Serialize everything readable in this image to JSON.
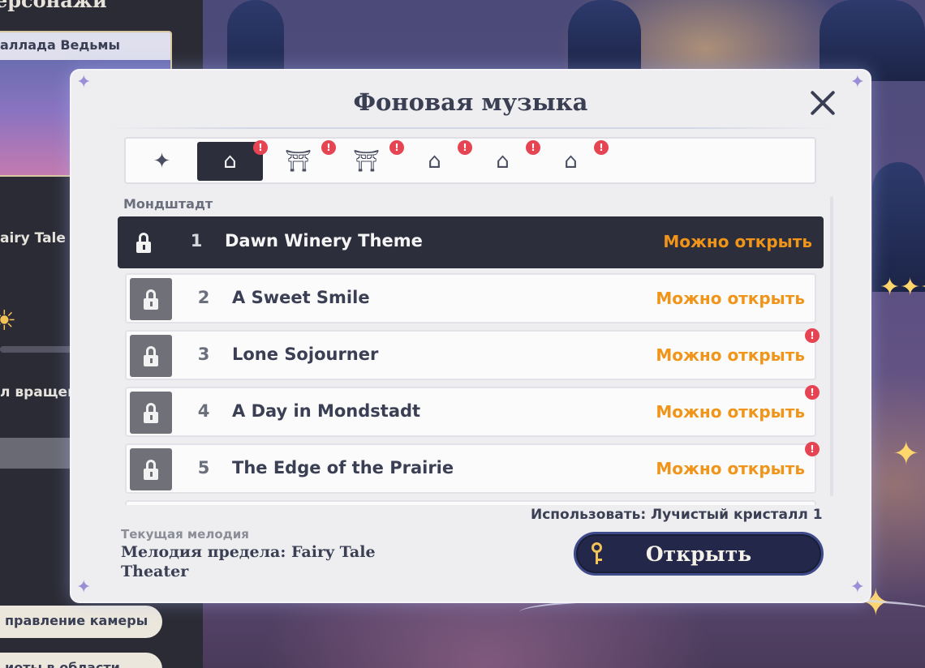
{
  "side_panel": {
    "title": "ерсонажи",
    "card_label": "аллада Ведьмы",
    "row_fairy_tale": "airy Tale",
    "row_rotation": "л вращени",
    "pill_camera": "правление камеры",
    "pill_area": "иоты в области"
  },
  "dialog": {
    "title": "Фоновая музыка",
    "section_label": "Мондштадт",
    "tabs": [
      {
        "icon": "sparkle-star-icon",
        "glyph": "✦",
        "badge": ""
      },
      {
        "icon": "mondstadt-house-icon",
        "glyph": "⌂",
        "badge": "!"
      },
      {
        "icon": "liyue-pavilion-icon",
        "glyph": "⛩",
        "badge": "!"
      },
      {
        "icon": "inazuma-gate-icon",
        "glyph": "⛩",
        "badge": "!"
      },
      {
        "icon": "sumeru-dome-icon",
        "glyph": "⌂",
        "badge": "!"
      },
      {
        "icon": "fontaine-building-icon",
        "glyph": "⌂",
        "badge": "!"
      },
      {
        "icon": "natlan-tower-icon",
        "glyph": "⌂",
        "badge": "!"
      }
    ],
    "songs": [
      {
        "num": "1",
        "title": "Dawn Winery Theme",
        "status": "Можно открыть",
        "alert": ""
      },
      {
        "num": "2",
        "title": "A Sweet Smile",
        "status": "Можно открыть",
        "alert": ""
      },
      {
        "num": "3",
        "title": "Lone Sojourner",
        "status": "Можно открыть",
        "alert": "!"
      },
      {
        "num": "4",
        "title": "A Day in Mondstadt",
        "status": "Можно открыть",
        "alert": "!"
      },
      {
        "num": "5",
        "title": "The Edge of the Prairie",
        "status": "Можно открыть",
        "alert": "!"
      }
    ],
    "cost_text": "Использовать: Лучистый кристалл 1",
    "current_label": "Текущая мелодия",
    "current_value": "Мелодия предела: Fairy Tale Theater",
    "open_button": "Открыть"
  },
  "colors": {
    "status_orange": "#f0951a",
    "alert_red": "#e54552",
    "dark_panel": "#2d2e3c",
    "key_gold": "#f3c257"
  }
}
